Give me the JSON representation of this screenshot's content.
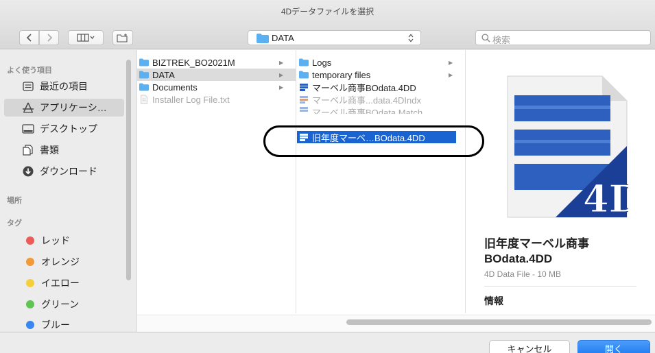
{
  "window": {
    "title": "4Dデータファイルを選択"
  },
  "toolbar": {
    "location": "DATA",
    "search_placeholder": "検索"
  },
  "sidebar": {
    "favorites_header": "よく使う項目",
    "favorites": [
      {
        "label": "最近の項目",
        "icon": "recents-icon"
      },
      {
        "label": "アプリケーシ…",
        "icon": "applications-icon",
        "selected": true
      },
      {
        "label": "デスクトップ",
        "icon": "desktop-icon"
      },
      {
        "label": "書類",
        "icon": "documents-icon"
      },
      {
        "label": "ダウンロード",
        "icon": "downloads-icon"
      }
    ],
    "places_header": "場所",
    "tags_header": "タグ",
    "tags": [
      {
        "label": "レッド",
        "color": "#ec5b57"
      },
      {
        "label": "オレンジ",
        "color": "#f29a38"
      },
      {
        "label": "イエロー",
        "color": "#f5cf3a"
      },
      {
        "label": "グリーン",
        "color": "#5fc451"
      },
      {
        "label": "ブルー",
        "color": "#3a86f0"
      }
    ]
  },
  "column1": [
    {
      "label": "BIZTREK_BO2021M",
      "type": "folder"
    },
    {
      "label": "DATA",
      "type": "folder",
      "selected": true
    },
    {
      "label": "Documents",
      "type": "folder"
    },
    {
      "label": "Installer Log File.txt",
      "type": "file",
      "dim": true
    }
  ],
  "column2": [
    {
      "label": "Logs",
      "type": "folder"
    },
    {
      "label": "temporary files",
      "type": "folder"
    },
    {
      "label": "マーベル商事BOdata.4DD",
      "type": "4dd"
    },
    {
      "label": "マーベル商事...data.4DIndx",
      "type": "4dindx",
      "dim": true
    },
    {
      "label": "マーベル商事BOdata.Match",
      "type": "match",
      "dim": true
    },
    {
      "label": "旧年度マーベ…BOdata.4DD",
      "type": "4dd",
      "selected": true
    }
  ],
  "preview": {
    "name_line1": "旧年度マーベル商事",
    "name_line2": "BOdata.4DD",
    "kind": "4D Data File - 10 MB",
    "info_header": "情報"
  },
  "buttons": {
    "cancel": "キャンセル",
    "open": "開く"
  },
  "colors": {
    "accent": "#1a64d2",
    "open_button": "#1d7bf3"
  }
}
